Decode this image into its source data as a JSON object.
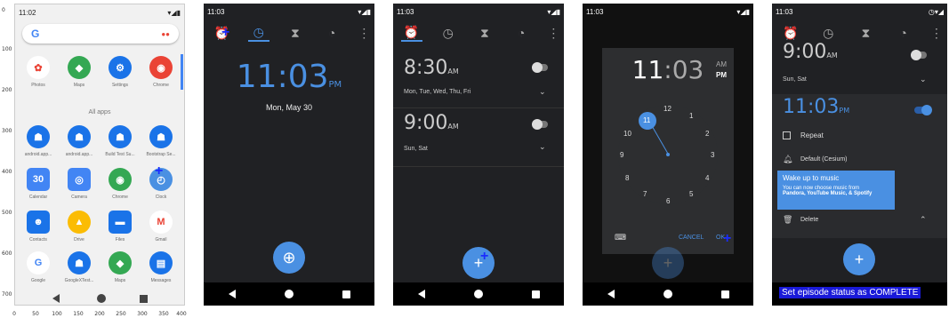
{
  "axis": {
    "yticks": [
      "100",
      "200",
      "300",
      "400",
      "500",
      "600",
      "700"
    ],
    "xticks": [
      "0",
      "50",
      "100",
      "150",
      "200",
      "250",
      "300",
      "350",
      "400"
    ]
  },
  "p1": {
    "time": "11:02",
    "search_g": "G",
    "row1": [
      "Photos",
      "Maps",
      "Settings",
      "Chrome"
    ],
    "allapps": "All apps",
    "row2": [
      "android.app...",
      "android.app...",
      "Build Test Su...",
      "Bootstrap Se..."
    ],
    "row3": [
      "Calendar",
      "Camera",
      "Chrome",
      "Clock"
    ],
    "row4": [
      "Contacts",
      "Drive",
      "Files",
      "Gmail"
    ],
    "row5": [
      "Google",
      "GoogleXTest...",
      "Maps",
      "Messages"
    ],
    "calendar_num": "30"
  },
  "p2": {
    "status_time": "11:03",
    "clock": "11:03",
    "ampm": "PM",
    "date": "Mon, May 30"
  },
  "p3": {
    "status_time": "11:03",
    "alarm1_time": "8:30",
    "alarm1_ampm": "AM",
    "alarm1_days": "Mon, Tue, Wed, Thu, Fri",
    "alarm2_time": "9:00",
    "alarm2_ampm": "AM",
    "alarm2_days": "Sun, Sat"
  },
  "p4": {
    "status_time": "11:03",
    "hour": "11",
    "colon": ":",
    "minute": "03",
    "am": "AM",
    "pm": "PM",
    "nums": [
      "12",
      "1",
      "2",
      "3",
      "4",
      "5",
      "6",
      "7",
      "8",
      "9",
      "10",
      "11"
    ],
    "cancel": "CANCEL",
    "ok": "OK"
  },
  "p5": {
    "status_time": "11:03",
    "top_time": "9:00",
    "top_ampm": "AM",
    "top_days": "Sun, Sat",
    "time": "11:03",
    "ampm": "PM",
    "repeat": "Repeat",
    "ringtone": "Default (Cesium)",
    "tip_title": "Wake up to music",
    "tip_body": "You can now choose music from",
    "tip_brands": "Pandora, YouTube Music, & Spotify",
    "delete": "Delete",
    "banner": "Set episode status as COMPLETE"
  }
}
